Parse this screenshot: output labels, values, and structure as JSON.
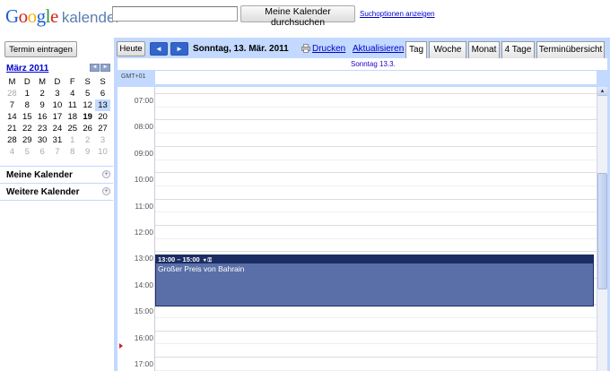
{
  "header": {
    "logo_google": "Google",
    "logo_product": "kalender",
    "search_value": "",
    "search_button": "Meine Kalender durchsuchen",
    "search_options": "Suchoptionen anzeigen"
  },
  "sidebar": {
    "create_button": "Termin eintragen",
    "month_title": "März 2011",
    "prev_icon": "chevron-left-icon",
    "next_icon": "chevron-right-icon",
    "weekdays": [
      "M",
      "D",
      "M",
      "D",
      "F",
      "S",
      "S"
    ],
    "weeks": [
      [
        "28",
        "1",
        "2",
        "3",
        "4",
        "5",
        "6"
      ],
      [
        "7",
        "8",
        "9",
        "10",
        "11",
        "12",
        "13"
      ],
      [
        "14",
        "15",
        "16",
        "17",
        "18",
        "19",
        "20"
      ],
      [
        "21",
        "22",
        "23",
        "24",
        "25",
        "26",
        "27"
      ],
      [
        "28",
        "29",
        "30",
        "31",
        "1",
        "2",
        "3"
      ],
      [
        "4",
        "5",
        "6",
        "7",
        "8",
        "9",
        "10"
      ]
    ],
    "sections": [
      "Meine Kalender",
      "Weitere Kalender"
    ]
  },
  "toolbar": {
    "today_button": "Heute",
    "prev_label": "◄",
    "next_label": "►",
    "date_title": "Sonntag, 13. Mär. 2011",
    "print_label": "Drucken",
    "refresh_label": "Aktualisieren",
    "tabs": [
      "Tag",
      "Woche",
      "Monat",
      "4 Tage",
      "Terminübersicht"
    ],
    "active_tab": "Tag"
  },
  "day_view": {
    "day_header": "Sonntag 13.3.",
    "timezone": "GMT+01",
    "hours": [
      "07:00",
      "08:00",
      "09:00",
      "10:00",
      "11:00",
      "12:00",
      "13:00",
      "14:00",
      "15:00",
      "16:00",
      "17:00"
    ],
    "event": {
      "time": "13:00 – 15:00",
      "title": "Großer Preis von Bahrain"
    }
  },
  "colors": {
    "accent": "#c3d9ff",
    "event_bg": "#5a6fa8",
    "event_head": "#1b2c63",
    "nav_blue": "#3366cc"
  }
}
